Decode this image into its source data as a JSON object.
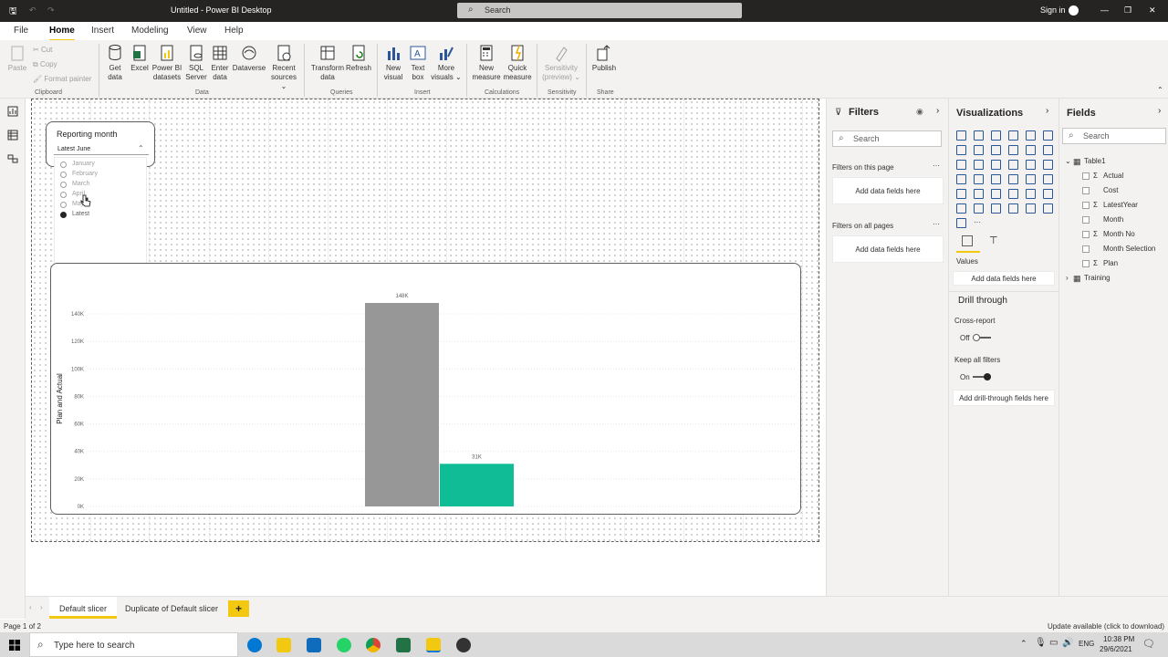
{
  "window": {
    "title": "Untitled - Power BI Desktop",
    "search_placeholder": "Search",
    "sign_in": "Sign in"
  },
  "menu_tabs": [
    "File",
    "Home",
    "Insert",
    "Modeling",
    "View",
    "Help"
  ],
  "ribbon": {
    "clipboard": {
      "paste": "Paste",
      "cut": "Cut",
      "copy": "Copy",
      "format_painter": "Format painter",
      "group": "Clipboard"
    },
    "data": {
      "get_data": "Get data",
      "excel": "Excel",
      "pbi_datasets": "Power BI datasets",
      "sql_server": "SQL Server",
      "enter_data": "Enter data",
      "dataverse": "Dataverse",
      "recent_sources": "Recent sources",
      "group": "Data"
    },
    "queries": {
      "transform": "Transform data",
      "refresh": "Refresh",
      "group": "Queries"
    },
    "insert": {
      "new_visual": "New visual",
      "text_box": "Text box",
      "more_visuals": "More visuals",
      "group": "Insert"
    },
    "calculations": {
      "new_measure": "New measure",
      "quick_measure": "Quick measure",
      "group": "Calculations"
    },
    "sensitivity": {
      "label": "Sensitivity (preview)",
      "group": "Sensitivity"
    },
    "share": {
      "publish": "Publish",
      "group": "Share"
    }
  },
  "slicer": {
    "title": "Reporting month",
    "selected": "Latest June",
    "options": [
      "January",
      "February",
      "March",
      "April",
      "May",
      "Latest"
    ],
    "selected_option": "Latest"
  },
  "chart_data": {
    "type": "bar",
    "categories": [
      "",
      ""
    ],
    "values": [
      148000,
      31000
    ],
    "data_labels": [
      "148K",
      "31K"
    ],
    "colors": [
      "#979797",
      "#0fbc96"
    ],
    "ylabel": "Plan and Actual",
    "ylim": [
      0,
      148000
    ],
    "y_ticks": [
      "0K",
      "20K",
      "40K",
      "60K",
      "80K",
      "100K",
      "120K",
      "140K"
    ],
    "grid": true
  },
  "filters": {
    "title": "Filters",
    "search": "Search",
    "on_this_page": "Filters on this page",
    "on_all_pages": "Filters on all pages",
    "add_fields": "Add data fields here"
  },
  "visualizations": {
    "title": "Visualizations",
    "values_label": "Values",
    "add_fields": "Add data fields here",
    "drill_through": "Drill through",
    "cross_report": "Cross-report",
    "cross_report_state": "Off",
    "keep_all_filters": "Keep all filters",
    "keep_all_state": "On",
    "add_drill": "Add drill-through fields here"
  },
  "fields": {
    "title": "Fields",
    "search": "Search",
    "table1": "Table1",
    "items": [
      "Actual",
      "Cost",
      "LatestYear",
      "Month",
      "Month No",
      "Month Selection",
      "Plan"
    ],
    "training": "Training"
  },
  "page_tabs": [
    "Default slicer",
    "Duplicate of Default slicer"
  ],
  "status": {
    "page": "Page 1 of 2",
    "update": "Update available (click to download)"
  },
  "taskbar": {
    "search": "Type here to search",
    "lang": "ENG",
    "time": "10:38 PM",
    "date": "29/6/2021"
  }
}
